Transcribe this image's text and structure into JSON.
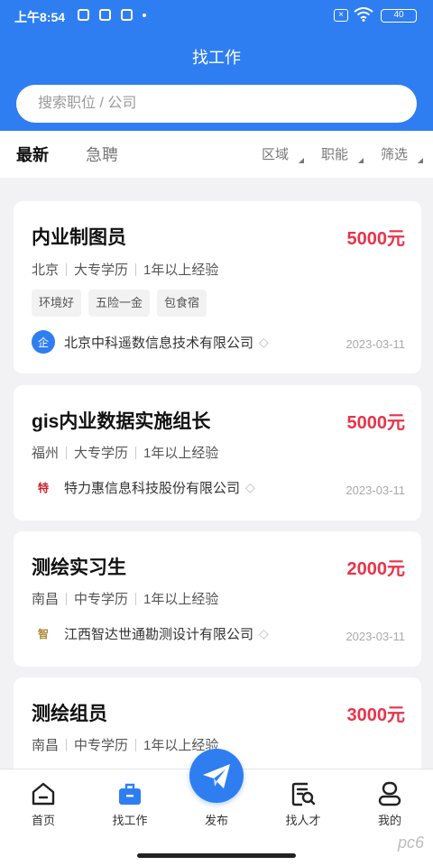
{
  "status_bar": {
    "time": "上午8:54",
    "battery": "40"
  },
  "header": {
    "title": "找工作",
    "search_placeholder": "搜索职位 / 公司"
  },
  "tabs": [
    {
      "label": "最新",
      "active": true
    },
    {
      "label": "急聘",
      "active": false
    }
  ],
  "filters": [
    {
      "label": "区域"
    },
    {
      "label": "职能"
    },
    {
      "label": "筛选"
    }
  ],
  "jobs": [
    {
      "title": "内业制图员",
      "salary": "5000元",
      "city": "北京",
      "education": "大专学历",
      "experience": "1年以上经验",
      "tags": [
        "环境好",
        "五险一金",
        "包食宿"
      ],
      "company": "北京中科遥数信息技术有限公司",
      "date": "2023-03-11",
      "logo_color": "#2f7ef1",
      "logo_glyph": "企"
    },
    {
      "title": "gis内业数据实施组长",
      "salary": "5000元",
      "city": "福州",
      "education": "大专学历",
      "experience": "1年以上经验",
      "tags": [],
      "company": "特力惠信息科技股份有限公司",
      "date": "2023-03-11",
      "logo_color": "#c7202b",
      "logo_glyph": "特"
    },
    {
      "title": "测绘实习生",
      "salary": "2000元",
      "city": "南昌",
      "education": "中专学历",
      "experience": "1年以上经验",
      "tags": [],
      "company": "江西智达世通勘测设计有限公司",
      "date": "2023-03-11",
      "logo_color": "#b08a3e",
      "logo_glyph": "智"
    },
    {
      "title": "测绘组员",
      "salary": "3000元",
      "city": "南昌",
      "education": "中专学历",
      "experience": "1年以上经验",
      "tags": [],
      "company": "",
      "date": "",
      "logo_color": "#b08a3e",
      "logo_glyph": ""
    }
  ],
  "bottom_nav": [
    {
      "label": "首页",
      "icon": "home-icon"
    },
    {
      "label": "找工作",
      "icon": "briefcase-icon",
      "active": true
    },
    {
      "label": "发布",
      "icon": "paper-plane-icon"
    },
    {
      "label": "找人才",
      "icon": "find-talent-icon"
    },
    {
      "label": "我的",
      "icon": "profile-icon"
    }
  ],
  "colors": {
    "brand": "#2f7ef1",
    "salary": "#e8334a"
  },
  "watermark": "pc6"
}
